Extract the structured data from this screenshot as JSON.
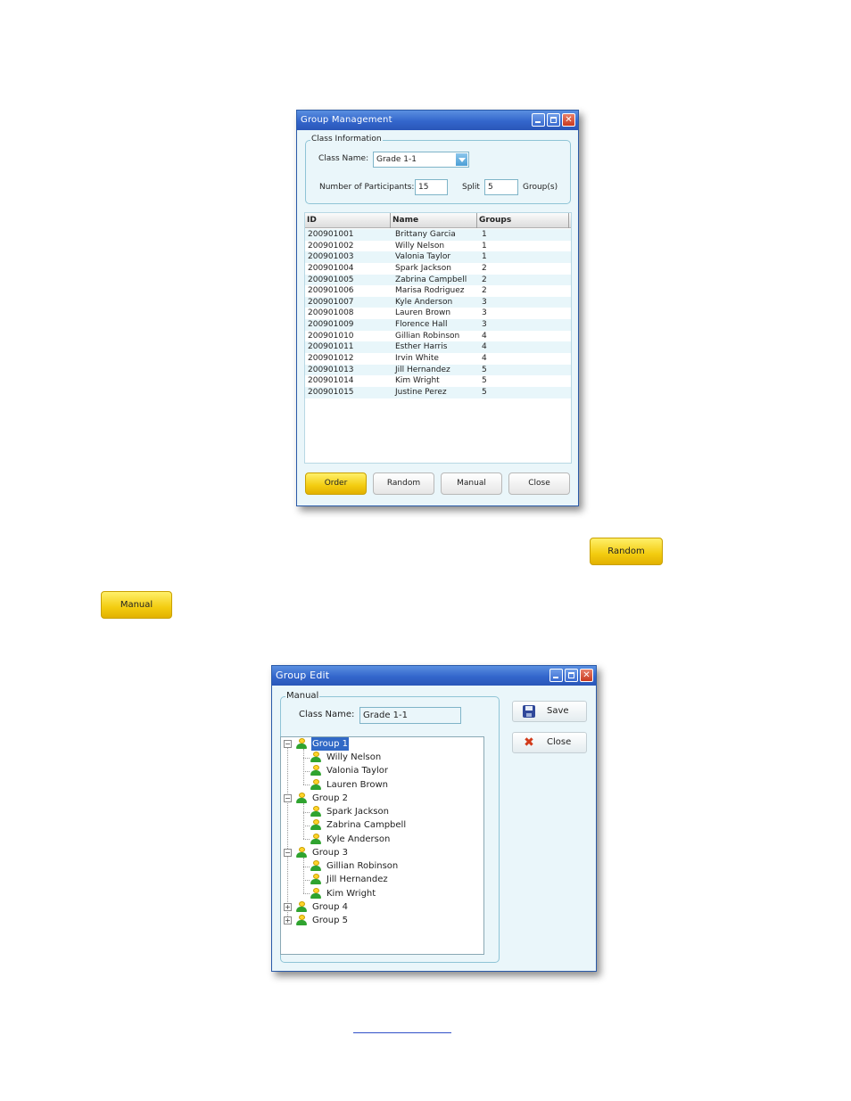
{
  "group_management": {
    "title": "Group Management",
    "class_info_legend": "Class Information",
    "class_name_label": "Class Name:",
    "class_name_value": "Grade 1-1",
    "participants_label": "Number of Participants:",
    "participants_value": "15",
    "split_label": "Split",
    "split_value": "5",
    "groups_suffix": "Group(s)",
    "columns": [
      "ID",
      "Name",
      "Groups"
    ],
    "rows": [
      {
        "id": "200901001",
        "name": "Brittany Garcia",
        "group": "1"
      },
      {
        "id": "200901002",
        "name": "Willy Nelson",
        "group": "1"
      },
      {
        "id": "200901003",
        "name": "Valonia Taylor",
        "group": "1"
      },
      {
        "id": "200901004",
        "name": "Spark Jackson",
        "group": "2"
      },
      {
        "id": "200901005",
        "name": "Zabrina Campbell",
        "group": "2"
      },
      {
        "id": "200901006",
        "name": "Marisa Rodriguez",
        "group": "2"
      },
      {
        "id": "200901007",
        "name": "Kyle Anderson",
        "group": "3"
      },
      {
        "id": "200901008",
        "name": "Lauren Brown",
        "group": "3"
      },
      {
        "id": "200901009",
        "name": "Florence Hall",
        "group": "3"
      },
      {
        "id": "200901010",
        "name": "Gillian Robinson",
        "group": "4"
      },
      {
        "id": "200901011",
        "name": "Esther Harris",
        "group": "4"
      },
      {
        "id": "200901012",
        "name": "Irvin White",
        "group": "4"
      },
      {
        "id": "200901013",
        "name": "Jill Hernandez",
        "group": "5"
      },
      {
        "id": "200901014",
        "name": "Kim Wright",
        "group": "5"
      },
      {
        "id": "200901015",
        "name": "Justine Perez",
        "group": "5"
      }
    ],
    "buttons": {
      "order": "Order",
      "random": "Random",
      "manual": "Manual",
      "close": "Close"
    }
  },
  "samples": {
    "random": "Random",
    "manual": "Manual"
  },
  "group_edit": {
    "title": "Group Edit",
    "legend": "Manual",
    "class_name_label": "Class Name:",
    "class_name_value": "Grade 1-1",
    "save_label": "Save",
    "close_label": "Close",
    "tree": {
      "g1": "Group 1",
      "g1_members": [
        "Willy Nelson",
        "Valonia Taylor",
        "Lauren Brown"
      ],
      "g2": "Group 2",
      "g2_members": [
        "Spark Jackson",
        "Zabrina Campbell",
        "Kyle Anderson"
      ],
      "g3": "Group 3",
      "g3_members": [
        "Gillian Robinson",
        "Jill  Hernandez",
        "Kim Wright"
      ],
      "g4": "Group 4",
      "g5": "Group 5"
    }
  },
  "colors": {
    "title_bar": "#3366cc",
    "window_bg": "#eaf6fa",
    "gold_button": "#f3cc10",
    "selection": "#3169c6"
  }
}
